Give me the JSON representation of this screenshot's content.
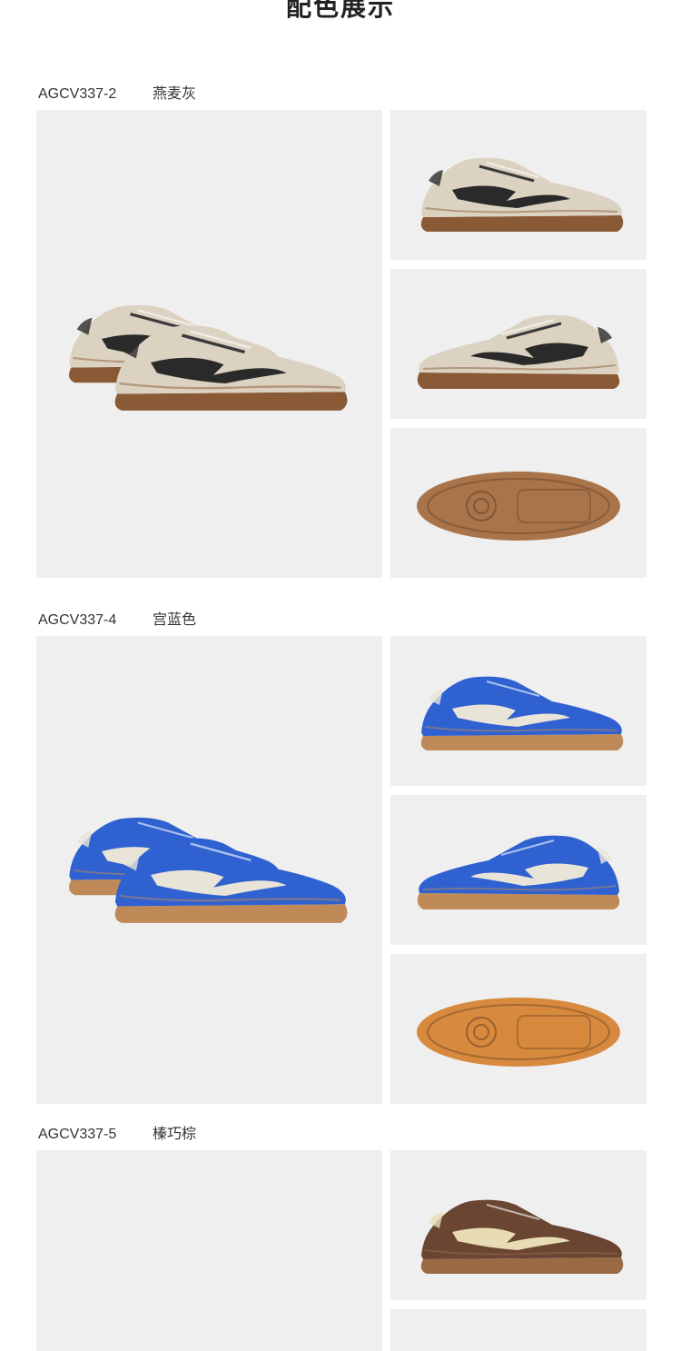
{
  "title": "配色展示",
  "variants": [
    {
      "code": "AGCV337-2",
      "color_name": "燕麦灰",
      "palette": {
        "upper": "#dcd2c2",
        "stripe": "#2a2a2a",
        "sole": "#8a5a36",
        "lace": "#3a3a3a",
        "outsole": "#a9744a"
      }
    },
    {
      "code": "AGCV337-4",
      "color_name": "宫蓝色",
      "palette": {
        "upper": "#2f62d0",
        "stripe": "#e9e4d8",
        "sole": "#c08a58",
        "lace": "#2f62d0",
        "outsole": "#d7893e"
      }
    },
    {
      "code": "AGCV337-5",
      "color_name": "榛巧棕",
      "palette": {
        "upper": "#6a4532",
        "stripe": "#e7dcb4",
        "sole": "#9a6a45",
        "lace": "#6a4532",
        "outsole": "#a9744a"
      }
    }
  ]
}
